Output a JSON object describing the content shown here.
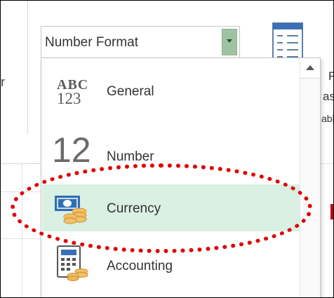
{
  "combo": {
    "value": "Number Format"
  },
  "dropdown": {
    "items": [
      {
        "label": "General",
        "icon": "abc-123-icon",
        "icon_text_top": "ABC",
        "icon_text_bottom": "123"
      },
      {
        "label": "Number",
        "icon": "number-12-icon",
        "icon_text": "12"
      },
      {
        "label": "Currency",
        "icon": "currency-icon",
        "selected": true
      },
      {
        "label": "Accounting",
        "icon": "accounting-icon"
      }
    ]
  },
  "background": {
    "left_snippet": "r",
    "right_snippets": [
      "F",
      "as",
      "abl"
    ]
  },
  "colors": {
    "selected_bg": "#d9f0e3",
    "annotation": "#e00000",
    "combo_button": "#9fc2a2"
  }
}
